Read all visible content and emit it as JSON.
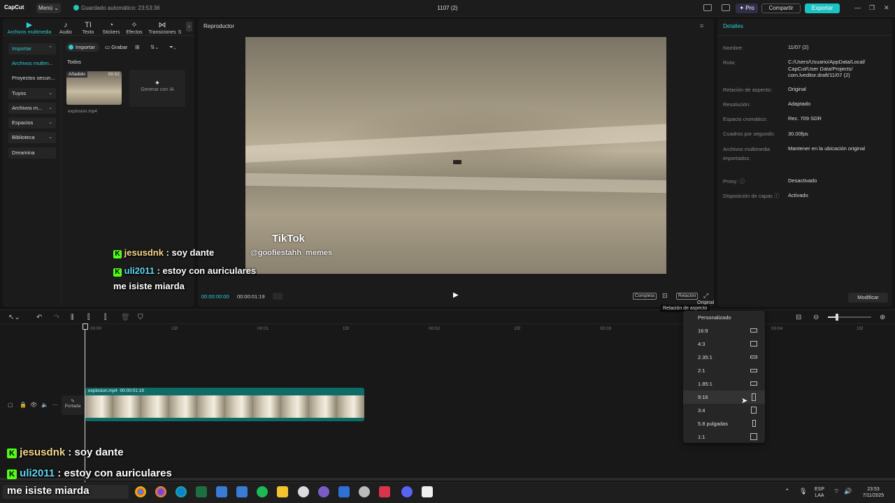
{
  "titlebar": {
    "logo": "CapCut",
    "menu": "Menú ⌄",
    "autosave": "Guardado automático: 23:53:36",
    "title": "1107 (2)",
    "pro": "✦ Pro",
    "share": "Compartir",
    "export": "Exportar"
  },
  "media": {
    "tabs": [
      {
        "label": "Archivos multimedia",
        "icon": "▶"
      },
      {
        "label": "Audio",
        "icon": "♪"
      },
      {
        "label": "Texto",
        "icon": "TI"
      },
      {
        "label": "Stickers",
        "icon": "◔"
      },
      {
        "label": "Efectos",
        "icon": "✧"
      },
      {
        "label": "Transiciones",
        "icon": "⋈"
      },
      {
        "label": "S",
        "icon": ""
      }
    ],
    "sidebar": [
      {
        "label": "Importar"
      },
      {
        "label": "Archivos multim..."
      },
      {
        "label": "Proyectos secun..."
      },
      {
        "label": "Tuyos"
      },
      {
        "label": "Archivos m..."
      },
      {
        "label": "Espacios"
      },
      {
        "label": "Biblioteca"
      },
      {
        "label": "Dreamina"
      }
    ],
    "import_btn": "Importar",
    "record_btn": "Grabar",
    "section": "Todos",
    "thumb_tag": "Añadido",
    "thumb_dur": "00:02",
    "thumb_name": "explosion.mp4",
    "ai_label": "Generar con IA"
  },
  "player": {
    "title": "Reproductor",
    "watermark": "TikTok",
    "handle": "@goofiestahh_memes",
    "time_current": "00:00:00:00",
    "time_total": "00:00:01:19",
    "btn_full": "Completa",
    "btn_ratio": "Relación"
  },
  "details": {
    "title": "Detalles",
    "rows": [
      {
        "key": "Nombre:",
        "value": "11/07 (2)"
      },
      {
        "key": "Ruta:",
        "value": "C:/Users/Usuario/AppData/Local/ CapCut/User Data/Projects/ com.lveditor.draft/11/07 (2)"
      },
      {
        "key": "Relación de aspecto:",
        "value": "Original"
      },
      {
        "key": "Resolución:",
        "value": "Adaptado"
      },
      {
        "key": "Espacio cromático:",
        "value": "Rec. 709 SDR"
      },
      {
        "key": "Cuadros por segundo:",
        "value": "30.00fps"
      },
      {
        "key": "Archivos multimedia importados:",
        "value": "Mantener en la ubicación original"
      },
      {
        "key": "Proxy: ⓘ",
        "value": "Desactivado"
      },
      {
        "key": "Disposición de capas ⓘ",
        "value": "Activado"
      }
    ],
    "modify": "Modificar"
  },
  "timeline": {
    "ruler": [
      "00:00",
      "15f",
      "00:01",
      "15f",
      "00:02",
      "15f",
      "00:03",
      "15f",
      "00:04",
      "15f"
    ],
    "clip_name": "explosion.mp4",
    "clip_dur": "00:00:01:19",
    "cover": "Portada"
  },
  "aspect_menu": {
    "current": "Original",
    "tooltip": "Relación de aspecto",
    "items": [
      "Personalizado",
      "16:9",
      "4:3",
      "2.35:1",
      "2:1",
      "1.85:1",
      "9:16",
      "3:4",
      "5.8 pulgadas",
      "1:1"
    ]
  },
  "chat": {
    "top": [
      {
        "user": "jesusdnk",
        "msg": " : soy dante"
      },
      {
        "user": "uli2011",
        "msg": " : estoy con auriculares"
      },
      {
        "user": "",
        "msg": "me isiste miarda"
      }
    ],
    "bottom": [
      {
        "user": "jesusdnk",
        "msg": " : soy dante"
      },
      {
        "user": "uli2011",
        "msg": " : estoy con auriculares"
      },
      {
        "user": "",
        "msg": "me isiste miarda"
      }
    ]
  },
  "taskbar": {
    "lang": "ESP",
    "lang2": "LAA",
    "time": "23:53",
    "date": "7/11/2025"
  },
  "colors": {
    "accent": "#2ccfd0",
    "export": "#1bc3c3",
    "clip": "#0f6b66",
    "kick": "#53fc18"
  }
}
